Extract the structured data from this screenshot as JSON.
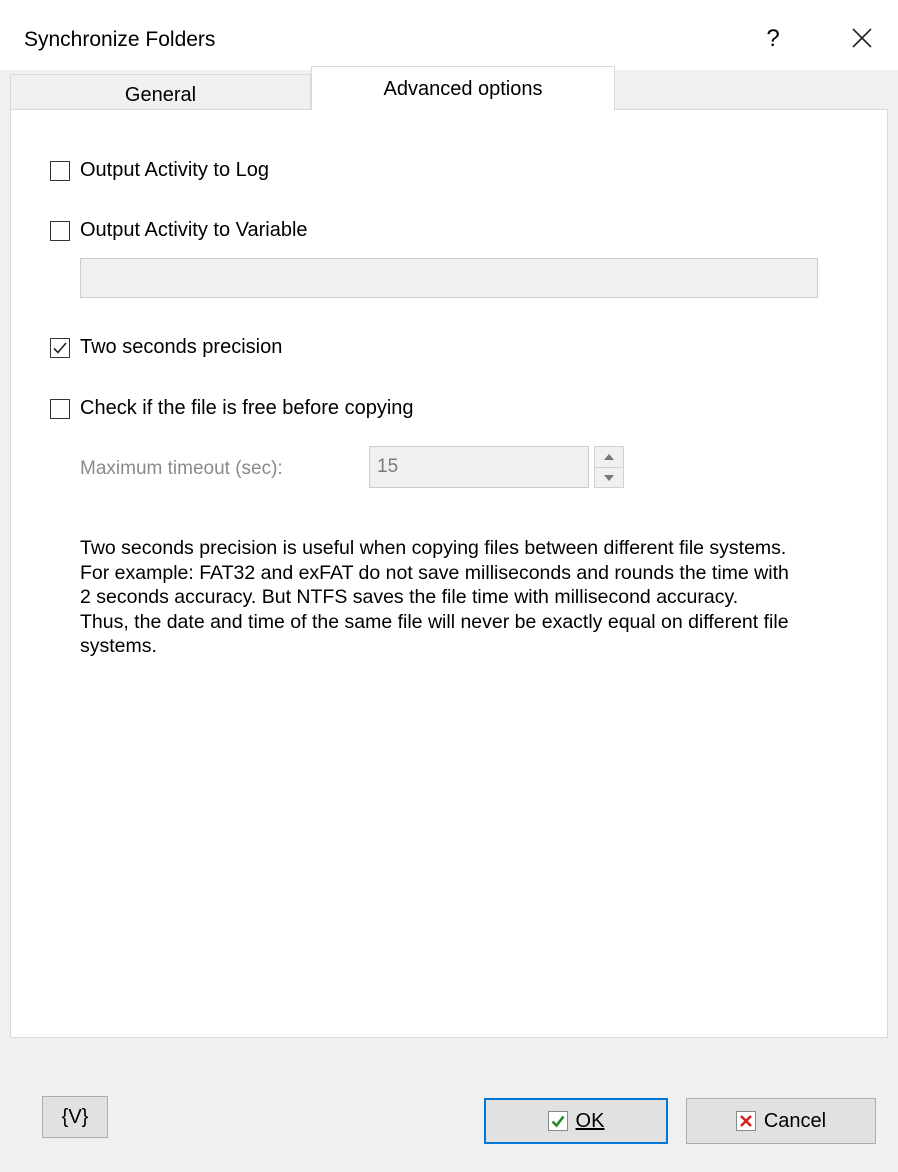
{
  "window": {
    "title": "Synchronize Folders",
    "help_label": "?"
  },
  "tabs": [
    {
      "label": "General",
      "selected": false
    },
    {
      "label": "Advanced options",
      "selected": true
    }
  ],
  "options": {
    "output_log": {
      "label": "Output Activity to Log",
      "checked": false
    },
    "output_variable": {
      "label": "Output Activity to Variable",
      "checked": false,
      "value": ""
    },
    "two_seconds": {
      "label": "Two seconds precision",
      "checked": true
    },
    "check_free": {
      "label": "Check if the file is free before copying",
      "checked": false
    }
  },
  "timeout": {
    "label": "Maximum timeout (sec):",
    "value": "15"
  },
  "info_text": "Two seconds precision is useful when copying files between different file systems. For example: FAT32 and exFAT do not save milliseconds and rounds the time with 2 seconds accuracy. But NTFS saves the file time with millisecond accuracy.\nThus, the date and time of the same file will never be exactly equal on different file systems.",
  "buttons": {
    "variables": "{V}",
    "ok": "OK",
    "cancel": "Cancel"
  },
  "colors": {
    "accent": "#0078d7",
    "ok_check": "#2a8a2a",
    "cancel_x": "#d42020"
  }
}
